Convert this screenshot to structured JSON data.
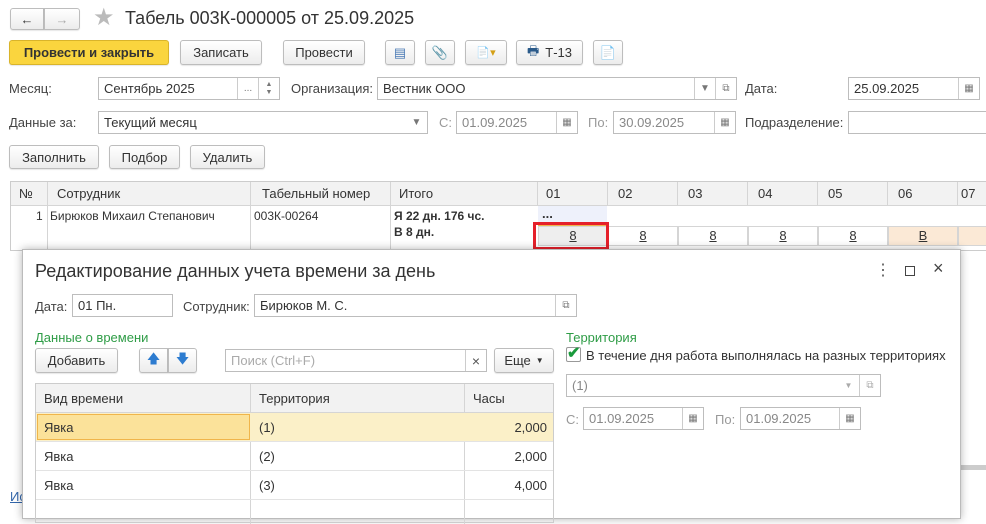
{
  "header": {
    "title": "Табель 003К-000005 от 25.09.2025"
  },
  "toolbar": {
    "post_close": "Провести и закрыть",
    "save": "Записать",
    "post": "Провести",
    "t13": "Т-13"
  },
  "form": {
    "month_label": "Месяц:",
    "month": "Сентябрь 2025",
    "month_btn": "...",
    "org_label": "Организация:",
    "org": "Вестник ООО",
    "date_label": "Дата:",
    "date": "25.09.2025",
    "data_for_label": "Данные за:",
    "data_for": "Текущий месяц",
    "from_label": "С:",
    "from": "01.09.2025",
    "to_label": "По:",
    "to": "30.09.2025",
    "dept_label": "Подразделение:",
    "dept": ""
  },
  "actions": {
    "fill": "Заполнить",
    "pick": "Подбор",
    "delete": "Удалить"
  },
  "table": {
    "headers": [
      "№",
      "Сотрудник",
      "Табельный номер",
      "Итого",
      "01",
      "02",
      "03",
      "04",
      "05",
      "06",
      "07"
    ],
    "row": {
      "num": "1",
      "employee": "Бирюков Михаил Степанович",
      "tab_no": "003К-00264",
      "total1": "Я 22 дн. 176 чс.",
      "total2": "В 8 дн.",
      "ellipsis": "...",
      "days": [
        "8",
        "8",
        "8",
        "8",
        "8",
        "В"
      ]
    }
  },
  "link_partial": "Ис",
  "dialog": {
    "title": "Редактирование данных учета времени за день",
    "date_label": "Дата:",
    "date": "01 Пн.",
    "employee_label": "Сотрудник:",
    "employee": "Бирюков М. С.",
    "time_section": "Данные о времени",
    "add": "Добавить",
    "search_placeholder": "Поиск (Ctrl+F)",
    "more": "Еще",
    "columns": [
      "Вид времени",
      "Территория",
      "Часы"
    ],
    "rows": [
      {
        "kind": "Явка",
        "territory": "(1)",
        "hours": "2,000"
      },
      {
        "kind": "Явка",
        "territory": "(2)",
        "hours": "2,000"
      },
      {
        "kind": "Явка",
        "territory": "(3)",
        "hours": "4,000"
      }
    ],
    "territory_section": "Территория",
    "multi_territory_label": "В течение дня работа выполнялась на разных территориях",
    "multi_territory_checked": true,
    "territory_value": "(1)",
    "from_label": "С:",
    "from": "01.09.2025",
    "to_label": "По:",
    "to": "01.09.2025"
  }
}
